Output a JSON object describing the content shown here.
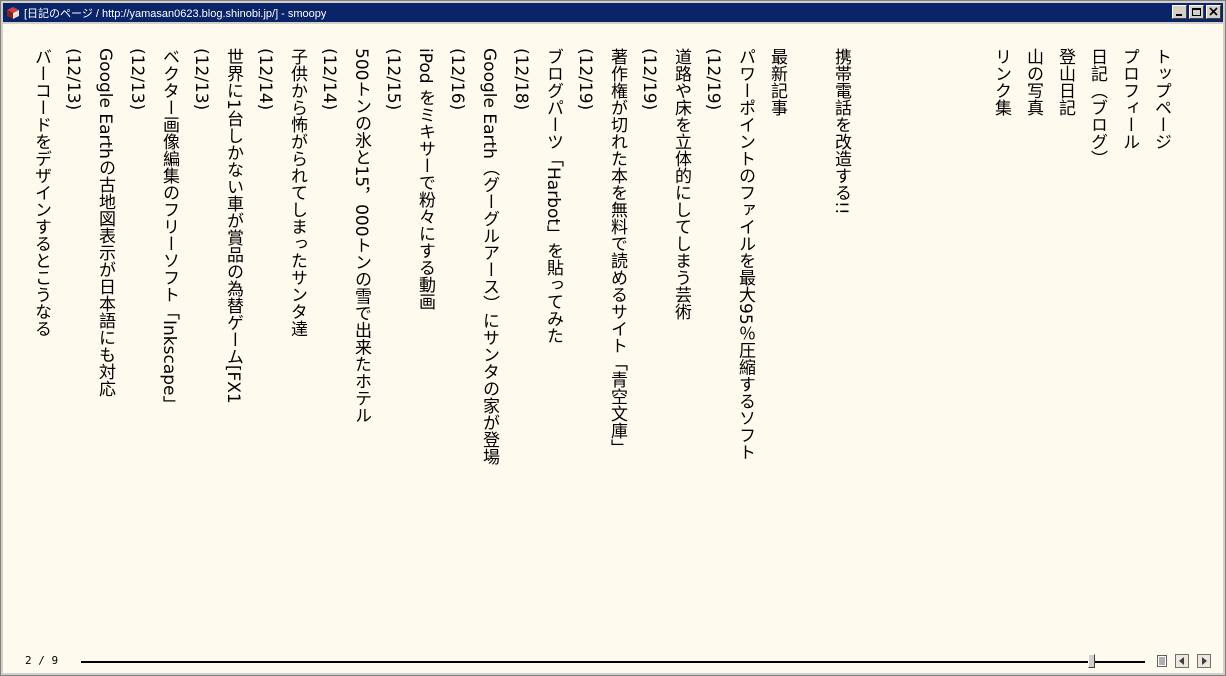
{
  "window": {
    "title": "[日記のページ / http://yamasan0623.blog.shinobi.jp/] - smoopy"
  },
  "nav": {
    "items": [
      "トップページ",
      "プロフィール",
      "日記（ブログ）",
      "登山日記",
      "山の写真",
      "リンク集"
    ]
  },
  "featured": {
    "text": "携帯電話を改造する!!"
  },
  "recent": {
    "heading": "最新記事",
    "entries": [
      {
        "title": "パワーポイントのファイルを最大95％圧縮するソフト",
        "date": "(12/19)"
      },
      {
        "title": "道路や床を立体的にしてしまう芸術",
        "date": "(12/19)"
      },
      {
        "title": "著作権が切れた本を無料で読めるサイト「青空文庫」",
        "date": "(12/19)"
      },
      {
        "title": "ブログパーツ「Harbot」を貼ってみた",
        "date": "(12/18)"
      },
      {
        "title": "Google Earth（グーグルアース）にサンタの家が登場",
        "date": "(12/16)"
      },
      {
        "title": "iPod をミキサーで粉々にする動画",
        "date": "(12/15)"
      },
      {
        "title": "500トンの氷と15，000トンの雪で出来たホテル",
        "date": "(12/14)"
      },
      {
        "title": "子供から怖がられてしまったサンタ達",
        "date": "(12/14)"
      },
      {
        "title": "世界に1台しかない車が賞品の為替ゲーム[FX1",
        "date": "(12/13)"
      },
      {
        "title": "ベクター画像編集のフリーソフト「Inkscape」",
        "date": "(12/13)"
      },
      {
        "title": "Google Earthの古地図表示が日本語にも対応",
        "date": "(12/13)"
      },
      {
        "title": "バーコードをデザインするとこうなる",
        "date": ""
      }
    ]
  },
  "status": {
    "page_indicator": "2 / 9",
    "slider_progress": 0.95
  },
  "icons": {
    "app": "book-icon",
    "minimize": "minimize-icon",
    "maximize": "maximize-icon",
    "close": "close-icon",
    "menu": "page-menu-icon",
    "prev": "prev-page-icon",
    "next": "next-page-icon"
  },
  "colors": {
    "titlebar": "#0a246a",
    "page_bg": "#fefaee"
  }
}
